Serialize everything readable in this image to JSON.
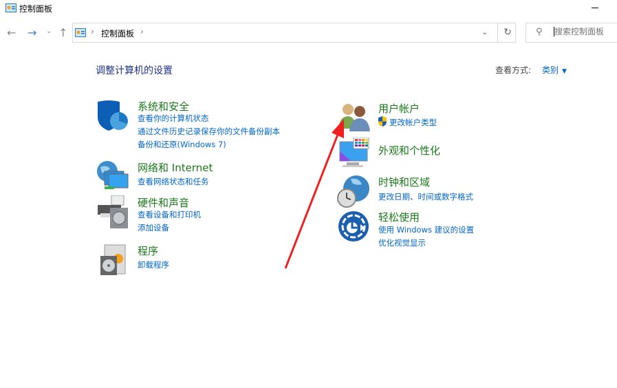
{
  "window": {
    "title": "控制面板",
    "icon": "control-panel-icon"
  },
  "nav": {
    "back": "←",
    "forward": "→",
    "recent": "⌄",
    "up": "↑"
  },
  "address": {
    "crumbs": [
      "控制面板"
    ],
    "separator": "›",
    "dropdown": "⌄",
    "refresh": "↻"
  },
  "search": {
    "placeholder": "搜索控制面板",
    "icon": "search-icon"
  },
  "main": {
    "heading": "调整计算机的设置",
    "view_by_label": "查看方式:",
    "view_by_value": "类别",
    "categories_left": [
      {
        "title": "系统和安全",
        "icon": "shield-icon",
        "links": [
          "查看你的计算机状态",
          "通过文件历史记录保存你的文件备份副本",
          "备份和还原(Windows 7)"
        ]
      },
      {
        "title": "网络和 Internet",
        "icon": "network-icon",
        "links": [
          "查看网络状态和任务"
        ]
      },
      {
        "title": "硬件和声音",
        "icon": "printer-icon",
        "links": [
          "查看设备和打印机",
          "添加设备"
        ]
      },
      {
        "title": "程序",
        "icon": "programs-icon",
        "links": [
          "卸载程序"
        ]
      }
    ],
    "categories_right": [
      {
        "title": "用户帐户",
        "icon": "users-icon",
        "links": [
          "更改帐户类型"
        ]
      },
      {
        "title": "外观和个性化",
        "icon": "monitor-palette-icon",
        "links": []
      },
      {
        "title": "时钟和区域",
        "icon": "clock-globe-icon",
        "links": [
          "更改日期、时间或数字格式"
        ]
      },
      {
        "title": "轻松使用",
        "icon": "ease-of-access-icon",
        "links": [
          "使用 Windows 建议的设置",
          "优化视觉显示"
        ]
      }
    ]
  },
  "colors": {
    "title_green": "#1a7a1a",
    "link_blue": "#0066cc",
    "heading_blue": "#1e3287",
    "annotation_red": "#f02020"
  }
}
